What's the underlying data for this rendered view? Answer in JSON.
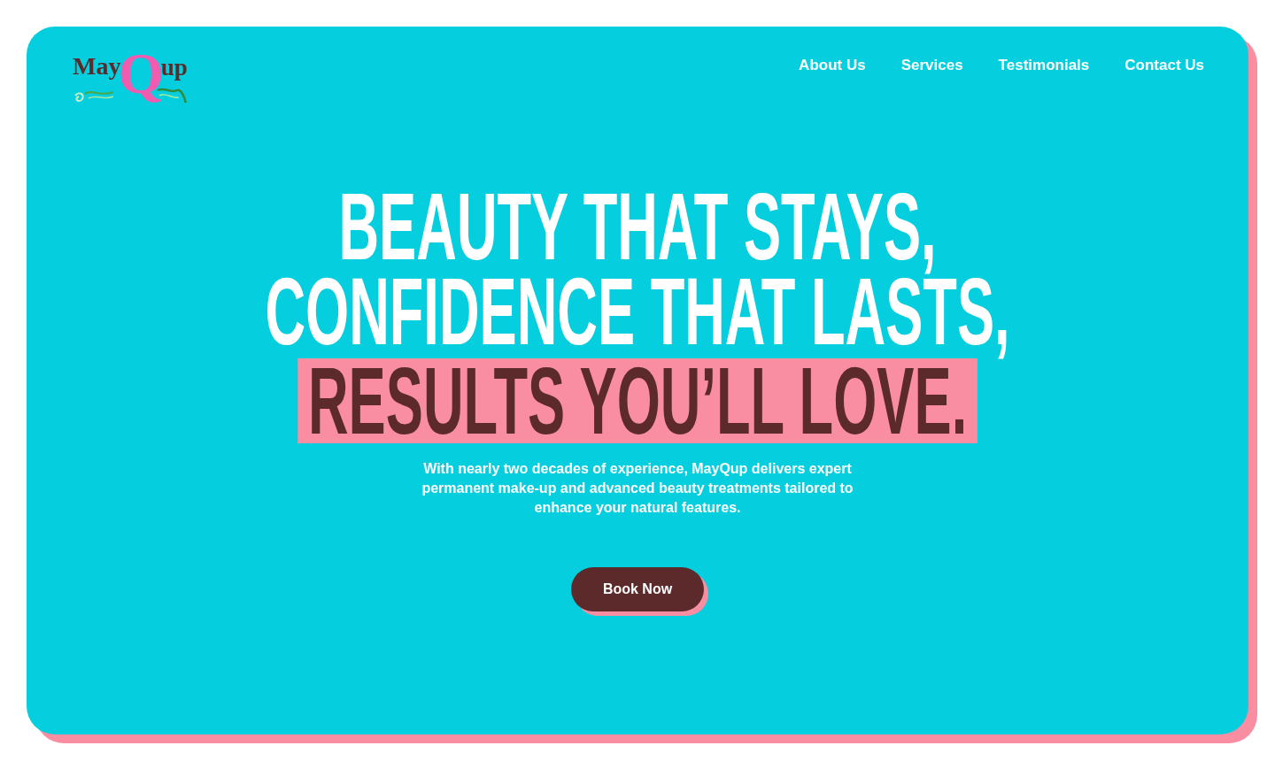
{
  "logo": {
    "parts": [
      "May",
      "Q",
      "up"
    ]
  },
  "nav": {
    "links": [
      "About Us",
      "Services",
      "Testimonials",
      "Contact Us"
    ]
  },
  "hero": {
    "headline": [
      {
        "text": "BEAUTY THAT STAYS,",
        "highlighted": false
      },
      {
        "text": "CONFIDENCE THAT LASTS,",
        "highlighted": false
      },
      {
        "text": "RESULTS YOU’LL LOVE.",
        "highlighted": true
      }
    ],
    "description": "With nearly two decades of experience, MayQup delivers expert permanent make-up and advanced beauty treatments tailored to enhance your natural features.",
    "cta": {
      "label": "Book Now"
    }
  }
}
